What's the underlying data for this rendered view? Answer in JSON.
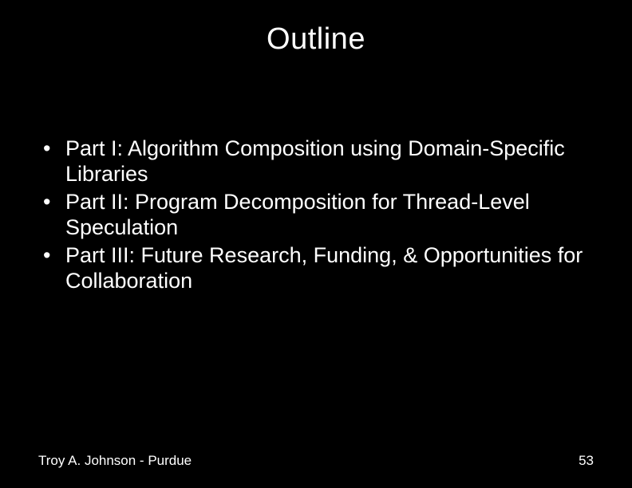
{
  "title": "Outline",
  "bullets": [
    "Part I: Algorithm Composition using Domain-Specific Libraries",
    "Part II: Program Decomposition for Thread-Level Speculation",
    "Part III: Future Research, Funding, & Opportunities for Collaboration"
  ],
  "footer": {
    "author": "Troy A. Johnson - Purdue",
    "page": "53"
  }
}
